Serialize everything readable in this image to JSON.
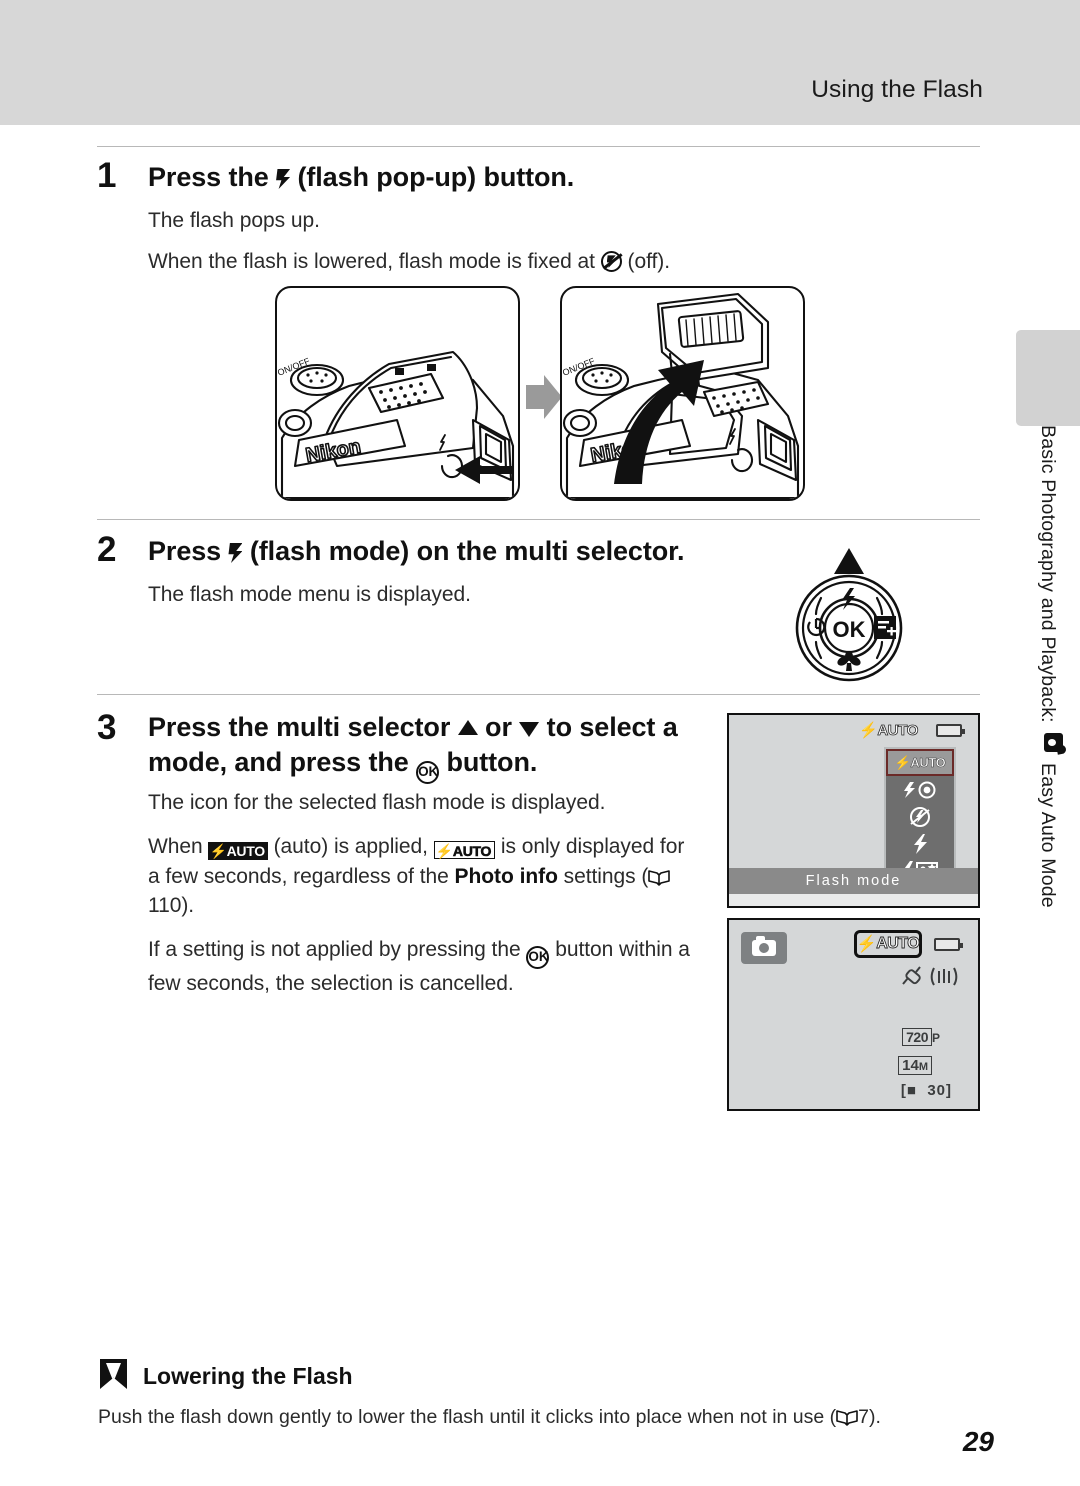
{
  "header": {
    "title": "Using the Flash"
  },
  "side_tab": {
    "label_part1": "Basic Photography and Playback:",
    "badge_icon": "easy-auto-mode-icon",
    "label_part2": "Easy Auto Mode"
  },
  "steps": [
    {
      "number": "1",
      "heading_before": "Press the",
      "heading_icon": "flash-icon",
      "heading_after": "(flash pop-up) button.",
      "body_lines": [
        "The flash pops up.",
        "When the flash is lowered, flash mode is fixed at"
      ],
      "body_line2_suffix": "(off).",
      "body_line2_icon": "flash-off-icon"
    },
    {
      "number": "2",
      "heading_before": "Press",
      "heading_icon": "flash-icon",
      "heading_after": "(flash mode) on the multi selector.",
      "body_lines": [
        "The flash mode menu is displayed."
      ]
    },
    {
      "number": "3",
      "heading_before": "Press the multi selector",
      "heading_mid": "or",
      "heading_after": "to select a",
      "heading_line2_before": "mode, and press the",
      "heading_line2_after": "button.",
      "body_line_1": "The icon for the selected flash mode is displayed.",
      "body_line_2_a": "When",
      "body_line_2_b": "(auto) is applied,",
      "body_line_2_c": "is only displayed for a few seconds, regardless of the",
      "body_line_2_bold": "Photo info",
      "body_line_2_d": "settings (",
      "body_line_2_page": "110",
      "body_line_2_e": ").",
      "body_line_3_a": "If a setting is not applied by pressing the",
      "body_line_3_b": "button within a few seconds, the selection is cancelled."
    }
  ],
  "illustrations": {
    "camera_brand": "Nikon",
    "camera_left_caption": "camera-flash-closed",
    "camera_right_caption": "camera-flash-popped-up",
    "multi_selector": {
      "center_label": "OK",
      "top_icon": "flash-icon",
      "left_icon": "self-timer-icon",
      "right_icon": "exposure-compensation-icon",
      "bottom_icon": "macro-flower-icon",
      "pointer": "up-arrow"
    }
  },
  "screens": {
    "flash_menu_screen": {
      "top_badge": "AUTO",
      "battery_icon": "battery-icon",
      "menu_items": [
        {
          "icon": "flash-auto-icon",
          "label": "AUTO",
          "selected": true
        },
        {
          "icon": "red-eye-reduction-icon",
          "label": "",
          "selected": false
        },
        {
          "icon": "flash-off-icon",
          "label": "",
          "selected": false
        },
        {
          "icon": "fill-flash-icon",
          "label": "",
          "selected": false
        },
        {
          "icon": "slow-sync-icon",
          "label": "",
          "selected": false
        }
      ],
      "caption_bar": "Flash mode"
    },
    "shooting_screen": {
      "mode_badge": "easy-auto-camera-icon",
      "flash_badge": "AUTO",
      "battery_icon": "battery-icon",
      "vr_icon": "vibration-reduction-icon",
      "af_icon": "af-assist-icon",
      "movie_size": "720",
      "movie_size_suffix": "P",
      "image_size": "14",
      "image_size_suffix": "M",
      "shots_remaining": "30"
    }
  },
  "note": {
    "title": "Lowering the Flash",
    "text_a": "Push the flash down gently to lower the flash until it clicks into place when not in use (",
    "text_page": "7",
    "text_b": ")."
  },
  "footer": {
    "page_number": "29"
  }
}
